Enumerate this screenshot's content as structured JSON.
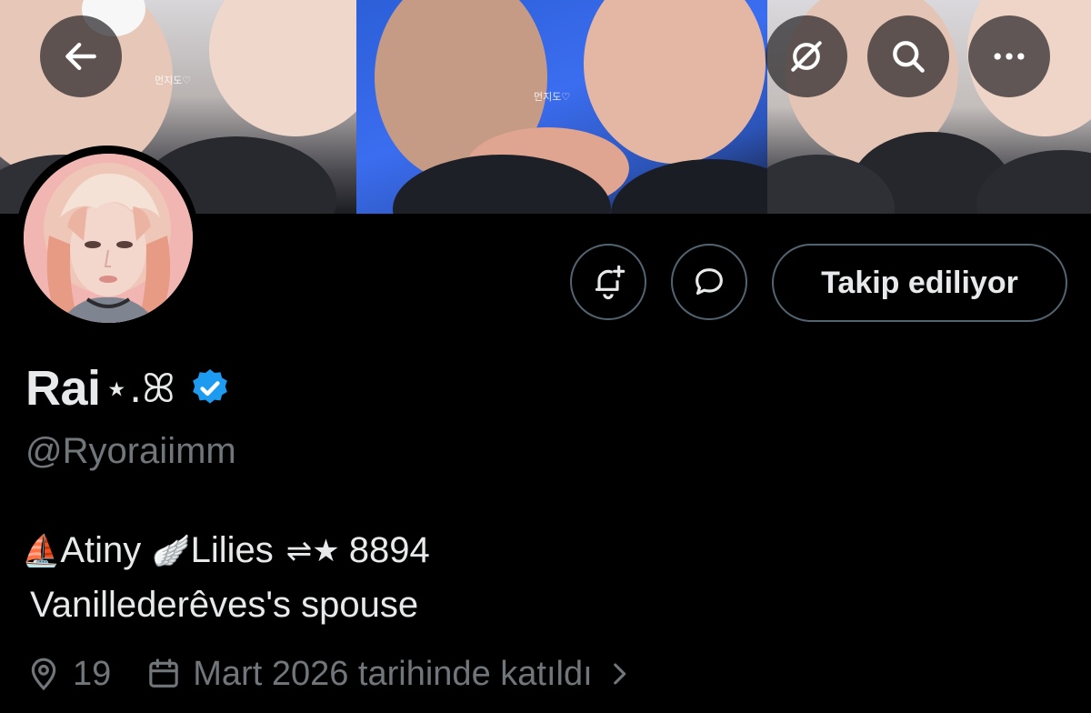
{
  "banner": {
    "watermark": "먼지도♡"
  },
  "profile": {
    "display_name": "Rai",
    "name_decoration": "⋆.ꕤ",
    "handle": "@Ryoraiimm",
    "bio_line1": {
      "emoji1": "⛵",
      "text1": "Atiny",
      "emoji2": "🪽",
      "text2": "Lilies",
      "emoji3": "⇌★",
      "text3": "8894"
    },
    "bio_line2": "Vanillederêves's spouse",
    "location": "19",
    "joined": "Mart 2026 tarihinde katıldı"
  },
  "actions": {
    "follow_label": "Takip ediliyor"
  },
  "colors": {
    "background": "#000000",
    "primary_text": "#e7e9ea",
    "secondary_text": "#71767b",
    "border": "#536471",
    "verified_blue": "#1d9bf0"
  }
}
